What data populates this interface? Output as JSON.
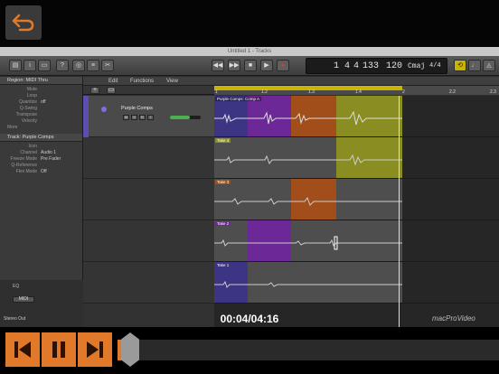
{
  "player": {
    "current_time": "00:04",
    "duration": "04:16",
    "time_display": "00:04/04:16",
    "progress": 0.016,
    "watermark": "macProVideo",
    "accent_color": "#e07a2a"
  },
  "app": {
    "window_title": "Untitled 1 - Tracks",
    "lcd": {
      "bar": "1",
      "beat": "4",
      "division": "4",
      "ticks": "133",
      "tempo": "120",
      "key": "Cmaj",
      "signature": "4/4"
    },
    "edit_menu": {
      "edit": "Edit",
      "functions": "Functions",
      "view": "View"
    },
    "ruler": [
      "1",
      "1.2",
      "1.3",
      "1.4",
      "2",
      "2.2",
      "2.3"
    ]
  },
  "inspector": {
    "region_header": "Region: MIDI Thru",
    "region_rows": [
      {
        "k": "Mute",
        "v": ""
      },
      {
        "k": "Loop",
        "v": ""
      },
      {
        "k": "Quantize",
        "v": "off"
      },
      {
        "k": "Q-Swing",
        "v": ""
      },
      {
        "k": "Transpose",
        "v": ""
      },
      {
        "k": "Velocity",
        "v": ""
      }
    ],
    "more": "More",
    "track_header": "Track: Purple Comps",
    "track_rows": [
      {
        "k": "Icon",
        "v": ""
      },
      {
        "k": "Channel",
        "v": "Audio 1"
      },
      {
        "k": "Freeze Mode",
        "v": "Pre Fader"
      },
      {
        "k": "Q-Reference",
        "v": ""
      },
      {
        "k": "Flex Mode",
        "v": "Off"
      }
    ],
    "lower": {
      "eq": "EQ",
      "midi": "MIDI",
      "stereo_out": "Stereo Out"
    }
  },
  "tracks": {
    "main_name": "Purple Comps",
    "comp_label": "Purple Comps: Comp A",
    "takes": [
      {
        "label": "Take 4",
        "color": "#8a8e22"
      },
      {
        "label": "Take 3",
        "color": "#a14e1a"
      },
      {
        "label": "Take 2",
        "color": "#6b2896"
      },
      {
        "label": "Take 1",
        "color": "#3c3584"
      }
    ]
  }
}
